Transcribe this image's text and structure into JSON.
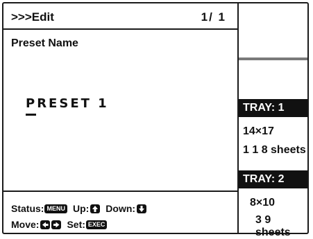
{
  "header": {
    "mode": ">>>Edit",
    "pager": "1/ 1"
  },
  "field": {
    "label": "Preset Name",
    "value": "PRESET 1"
  },
  "footer": {
    "status_label": "Status:",
    "status_key": "MENU",
    "up_label": "Up:",
    "down_label": "Down:",
    "move_label": "Move:",
    "set_label": "Set:",
    "set_key": "EXEC",
    "icons": {
      "up": "arrow-up-icon",
      "down": "arrow-down-icon",
      "left": "arrow-left-icon",
      "right": "arrow-right-icon"
    }
  },
  "trays": [
    {
      "label": "TRAY: 1",
      "size": "14×17",
      "sheets": "1 1 8 sheets"
    },
    {
      "label": "TRAY: 2",
      "size": "8×10",
      "sheets": "3 9 sheets"
    }
  ],
  "colors": {
    "ink": "#111111",
    "separator": "#7a7a7a",
    "background": "#ffffff"
  }
}
